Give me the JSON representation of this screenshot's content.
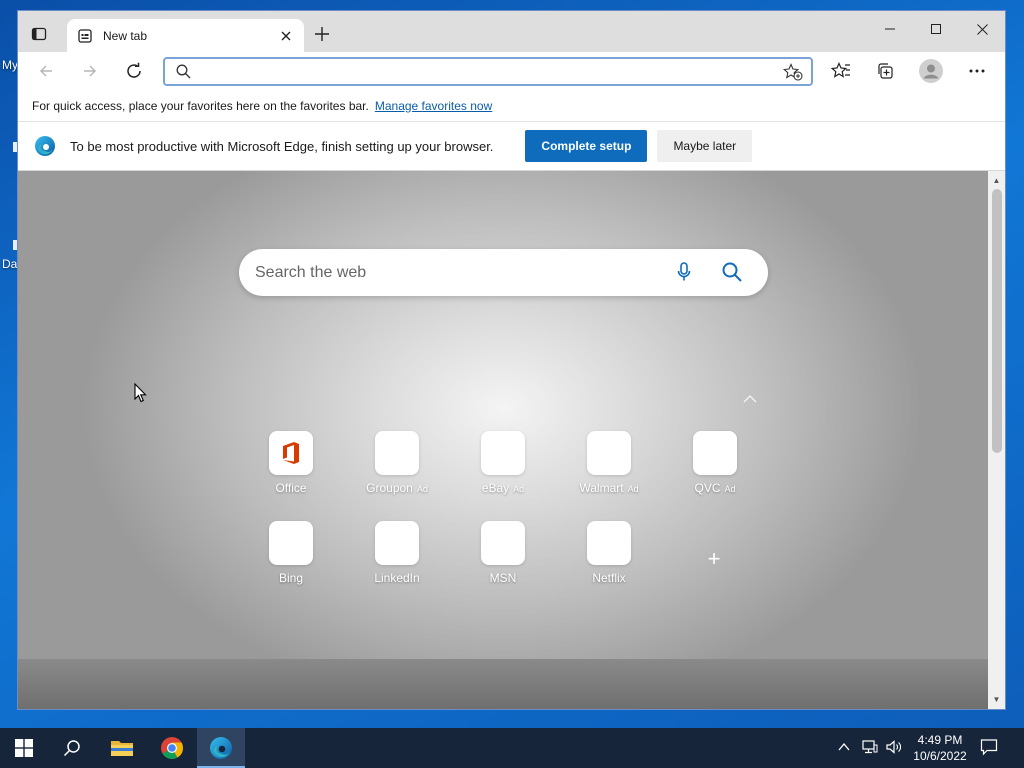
{
  "desktop": {
    "labels": [
      "My",
      "Da"
    ]
  },
  "browser": {
    "tab": {
      "title": "New tab"
    },
    "address": {
      "value": "",
      "placeholder": ""
    },
    "favorites_bar": {
      "message": "For quick access, place your favorites here on the favorites bar.",
      "link": "Manage favorites now"
    },
    "setup_bar": {
      "message": "To be most productive with Microsoft Edge, finish setting up your browser.",
      "primary": "Complete setup",
      "secondary": "Maybe later"
    },
    "newtab": {
      "search_placeholder": "Search the web",
      "tiles_row1": [
        {
          "label": "Office",
          "ad": ""
        },
        {
          "label": "Groupon",
          "ad": "Ad"
        },
        {
          "label": "eBay",
          "ad": "Ad"
        },
        {
          "label": "Walmart",
          "ad": "Ad"
        },
        {
          "label": "QVC",
          "ad": "Ad"
        }
      ],
      "tiles_row2": [
        {
          "label": "Bing",
          "ad": ""
        },
        {
          "label": "LinkedIn",
          "ad": ""
        },
        {
          "label": "MSN",
          "ad": ""
        },
        {
          "label": "Netflix",
          "ad": ""
        }
      ],
      "add_tile": "+"
    }
  },
  "taskbar": {
    "time": "4:49 PM",
    "date": "10/6/2022"
  },
  "colors": {
    "accent": "#0f6cbd",
    "link": "#0a5ea8",
    "taskbar": "#16253a"
  }
}
